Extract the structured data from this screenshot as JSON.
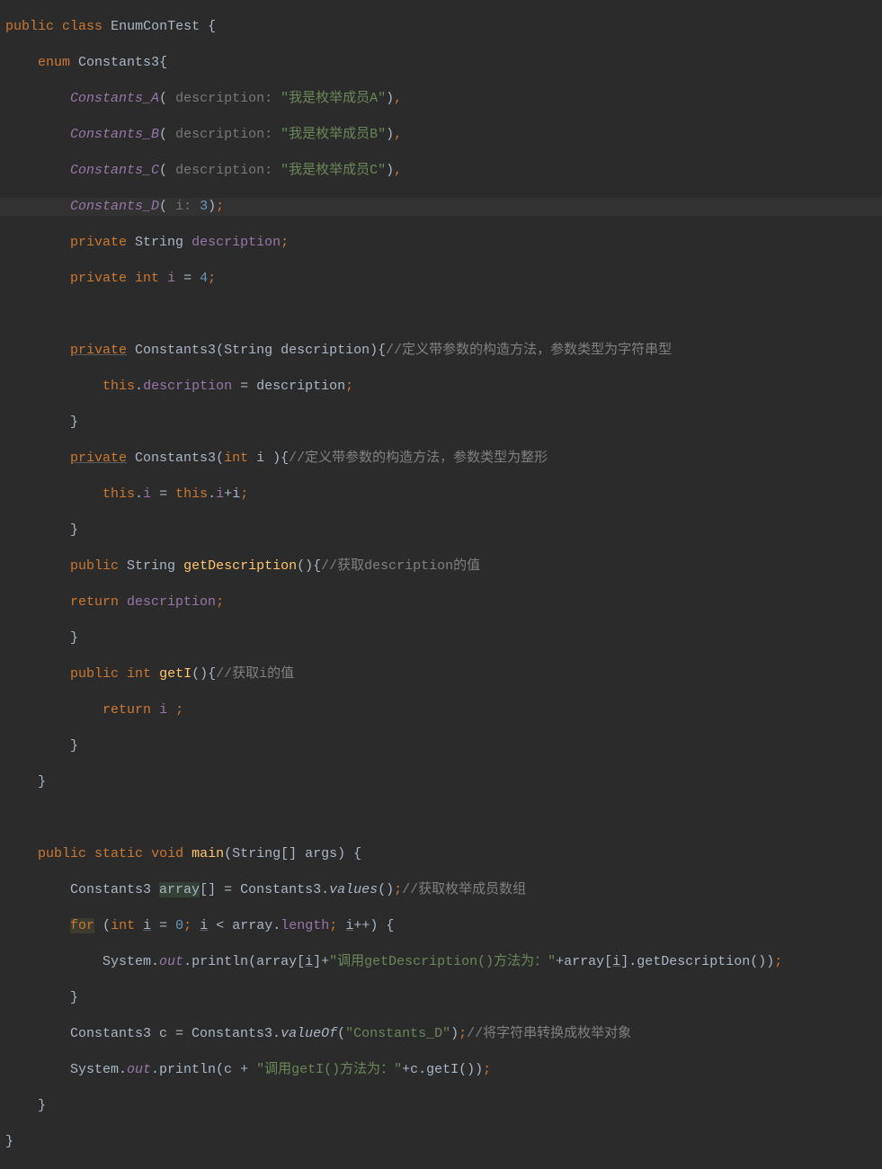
{
  "code": {
    "l1": {
      "public": "public",
      "class": "class",
      "name": "EnumConTest",
      "brace": "{"
    },
    "l2": {
      "enum": "enum",
      "name": "Constants3",
      "brace": "{"
    },
    "l3": {
      "const": "Constants_A",
      "hint": "description:",
      "str": "\"我是枚举成员A\"",
      "comma": ","
    },
    "l4": {
      "const": "Constants_B",
      "hint": "description:",
      "str": "\"我是枚举成员B\"",
      "comma": ","
    },
    "l5": {
      "const": "Constants_C",
      "hint": "description:",
      "str": "\"我是枚举成员C\"",
      "comma": ","
    },
    "l6": {
      "const": "Constants_D",
      "hint": "i:",
      "num": "3",
      "semi": ";"
    },
    "l7": {
      "private": "private",
      "type": "String",
      "field": "description",
      "semi": ";"
    },
    "l8": {
      "private": "private",
      "type": "int",
      "field": "i",
      "eq": "=",
      "num": "4",
      "semi": ";"
    },
    "l10": {
      "private": "private",
      "name": "Constants3",
      "params": "(String description){",
      "comment": "//定义带参数的构造方法，参数类型为字符串型"
    },
    "l11": {
      "this": "this",
      "dot": ".",
      "field": "description",
      "eq": "=",
      "var": "description",
      "semi": ";"
    },
    "l12": {
      "brace": "}"
    },
    "l13": {
      "private": "private",
      "name": "Constants3",
      "paren": "(",
      "int": "int",
      "param": "i ){",
      "comment": "//定义带参数的构造方法，参数类型为整形"
    },
    "l14": {
      "this": "this",
      "dot": ".",
      "field": "i",
      "eq": "=",
      "this2": "this",
      "dot2": ".",
      "field2": "i",
      "plus": "+",
      "var": "i",
      "semi": ";"
    },
    "l15": {
      "brace": "}"
    },
    "l16": {
      "public": "public",
      "type": "String",
      "method": "getDescription",
      "parens": "(){",
      "comment": "//获取description的值"
    },
    "l17": {
      "return": "return",
      "field": "description",
      "semi": ";"
    },
    "l18": {
      "brace": "}"
    },
    "l19": {
      "public": "public",
      "type": "int",
      "method": "getI",
      "parens": "(){",
      "comment": "//获取i的值"
    },
    "l20": {
      "return": "return",
      "field": "i",
      "semi": ";"
    },
    "l21": {
      "brace": "}"
    },
    "l22": {
      "brace": "}"
    },
    "l24": {
      "public": "public",
      "static": "static",
      "void": "void",
      "method": "main",
      "params": "(String[] args) {"
    },
    "l25": {
      "type": "Constants3",
      "var": "array",
      "brackets": "[] = Constants3.",
      "method": "values",
      "parens": "();",
      "comment": "//获取枚举成员数组"
    },
    "l26": {
      "for": "for",
      "paren": "(",
      "int": "int",
      "var": "i",
      "eq": "=",
      "num": "0",
      "semi": ";",
      "var2": "i",
      "lt": "<",
      "arr": "array.",
      "len": "length",
      "semi2": ";",
      "var3": "i",
      "inc": "++) {"
    },
    "l27": {
      "sys": "System.",
      "out": "out",
      "print": ".println(array[",
      "var": "i",
      "close": "]+",
      "str": "\"调用getDescription()方法为：\"",
      "plus": "+array[",
      "var2": "i",
      "end": "].getDescription())",
      "semi": ";"
    },
    "l28": {
      "brace": "}"
    },
    "l29": {
      "type": "Constants3 c = Constants3.",
      "method": "valueOf",
      "paren": "(",
      "str": "\"Constants_D\"",
      "close": ")",
      "semi": ";",
      "comment": "//将字符串转换成枚举对象"
    },
    "l30": {
      "sys": "System.",
      "out": "out",
      "print": ".println(c + ",
      "str": "\"调用getI()方法为：\"",
      "plus": "+c.getI())",
      "semi": ";"
    },
    "l31": {
      "brace": "}"
    },
    "l32": {
      "brace": "}"
    }
  }
}
